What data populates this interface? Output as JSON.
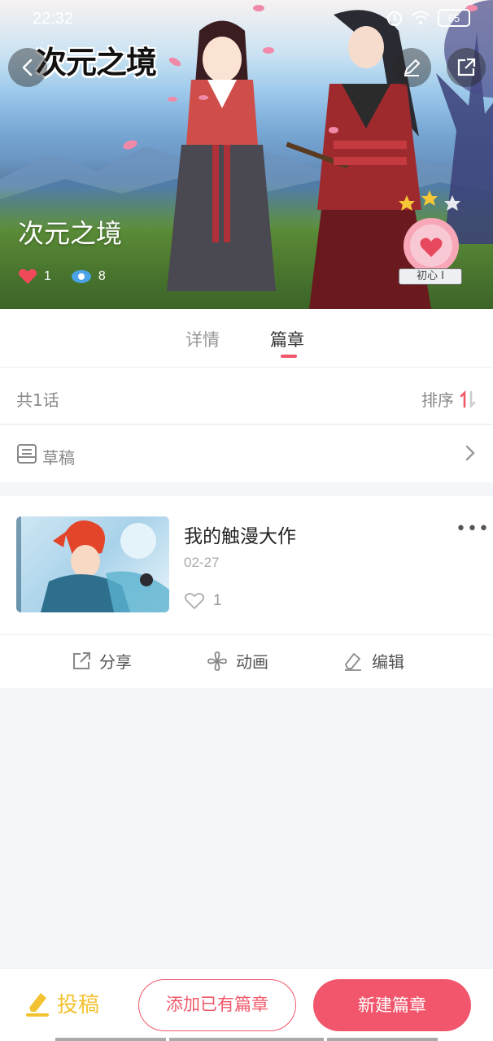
{
  "status_bar": {
    "time": "22:32",
    "battery": "65"
  },
  "header": {
    "logo_text": "次元之境",
    "title": "次元之境",
    "likes": "1",
    "views": "8",
    "badge_label": "初心 I"
  },
  "tabs": [
    {
      "label": "详情",
      "active": false
    },
    {
      "label": "篇章",
      "active": true
    }
  ],
  "chapters_summary": {
    "count": "共1话",
    "sort_label": "排序"
  },
  "drafts": {
    "label": "草稿"
  },
  "chapter": {
    "title": "我的触漫大作",
    "date": "02-27",
    "likes": "1",
    "more": "•••"
  },
  "actions": {
    "share": "分享",
    "animation": "动画",
    "edit": "编辑"
  },
  "bottom_bar": {
    "submit": "投稿",
    "add_existing": "添加已有篇章",
    "new_chapter": "新建篇章"
  },
  "colors": {
    "accent": "#f0586a",
    "submit_yellow": "#f2c230",
    "like_red": "#f04a5a",
    "view_blue": "#4aa3e8"
  }
}
